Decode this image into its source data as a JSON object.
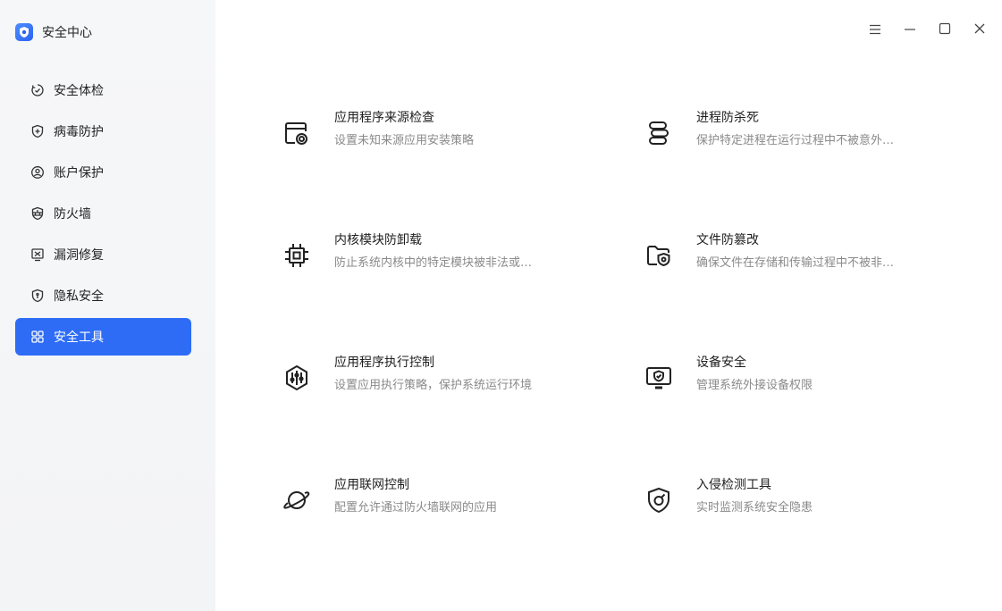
{
  "app": {
    "title": "安全中心"
  },
  "sidebar": {
    "items": [
      {
        "label": "安全体检",
        "icon": "scan-icon",
        "active": false
      },
      {
        "label": "病毒防护",
        "icon": "virus-shield-icon",
        "active": false
      },
      {
        "label": "账户保护",
        "icon": "account-icon",
        "active": false
      },
      {
        "label": "防火墙",
        "icon": "firewall-icon",
        "active": false
      },
      {
        "label": "漏洞修复",
        "icon": "vulnerability-icon",
        "active": false
      },
      {
        "label": "隐私安全",
        "icon": "privacy-icon",
        "active": false
      },
      {
        "label": "安全工具",
        "icon": "tools-grid-icon",
        "active": true
      }
    ]
  },
  "window_controls": {
    "menu": "menu-icon",
    "minimize": "minimize-icon",
    "maximize": "maximize-icon",
    "close": "close-icon"
  },
  "tools": [
    {
      "name": "应用程序来源检查",
      "desc": "设置未知来源应用安装策略",
      "icon": "app-source-check-icon"
    },
    {
      "name": "进程防杀死",
      "desc": "保护特定进程在运行过程中不被意外…",
      "icon": "process-protect-icon"
    },
    {
      "name": "内核模块防卸载",
      "desc": "防止系统内核中的特定模块被非法或…",
      "icon": "kernel-chip-icon"
    },
    {
      "name": "文件防篡改",
      "desc": "确保文件在存储和传输过程中不被非…",
      "icon": "file-protect-icon"
    },
    {
      "name": "应用程序执行控制",
      "desc": "设置应用执行策略，保护系统运行环境",
      "icon": "exec-control-icon"
    },
    {
      "name": "设备安全",
      "desc": "管理系统外接设备权限",
      "icon": "device-security-icon"
    },
    {
      "name": "应用联网控制",
      "desc": "配置允许通过防火墙联网的应用",
      "icon": "network-planet-icon"
    },
    {
      "name": "入侵检测工具",
      "desc": "实时监测系统安全隐患",
      "icon": "intrusion-detect-icon"
    }
  ],
  "colors": {
    "accent": "#2e6cf6",
    "sidebar_bg": "#f4f5f7",
    "desc_text": "#8a8a8a"
  }
}
